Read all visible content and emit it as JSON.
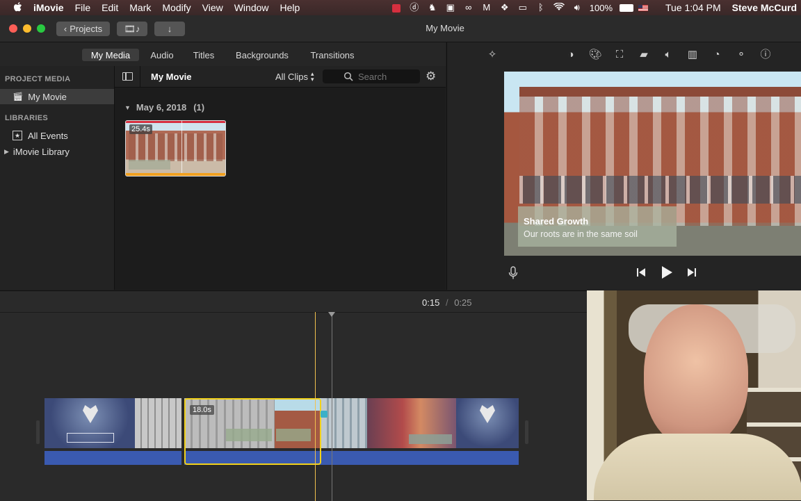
{
  "menubar": {
    "apple": "",
    "app": "iMovie",
    "items": [
      "File",
      "Edit",
      "Mark",
      "Modify",
      "View",
      "Window",
      "Help"
    ],
    "battery": "100%",
    "clock": "Tue 1:04 PM",
    "user": "Steve McCurd"
  },
  "toolbar": {
    "projects_label": "Projects",
    "title": "My Movie"
  },
  "tabs": [
    "My Media",
    "Audio",
    "Titles",
    "Backgrounds",
    "Transitions"
  ],
  "sidebar": {
    "project_media_header": "PROJECT MEDIA",
    "project_item": "My Movie",
    "libraries_header": "LIBRARIES",
    "library_items": [
      "All Events",
      "iMovie Library"
    ]
  },
  "browser": {
    "title": "My Movie",
    "filter": "All Clips",
    "search_placeholder": "Search",
    "event_date": "May 6, 2018",
    "event_count": "(1)",
    "clip_duration": "25.4s"
  },
  "viewer": {
    "overlay_title": "Shared Growth",
    "overlay_subtitle": "Our roots are in the same soil"
  },
  "timeline": {
    "current_time": "0:15",
    "separator": "/",
    "total_time": "0:25",
    "selected_clip_duration": "18.0s"
  },
  "colors": {
    "selection": "#f2d21b",
    "audio": "#3a5ab0",
    "playhead": "#f2c14e"
  }
}
